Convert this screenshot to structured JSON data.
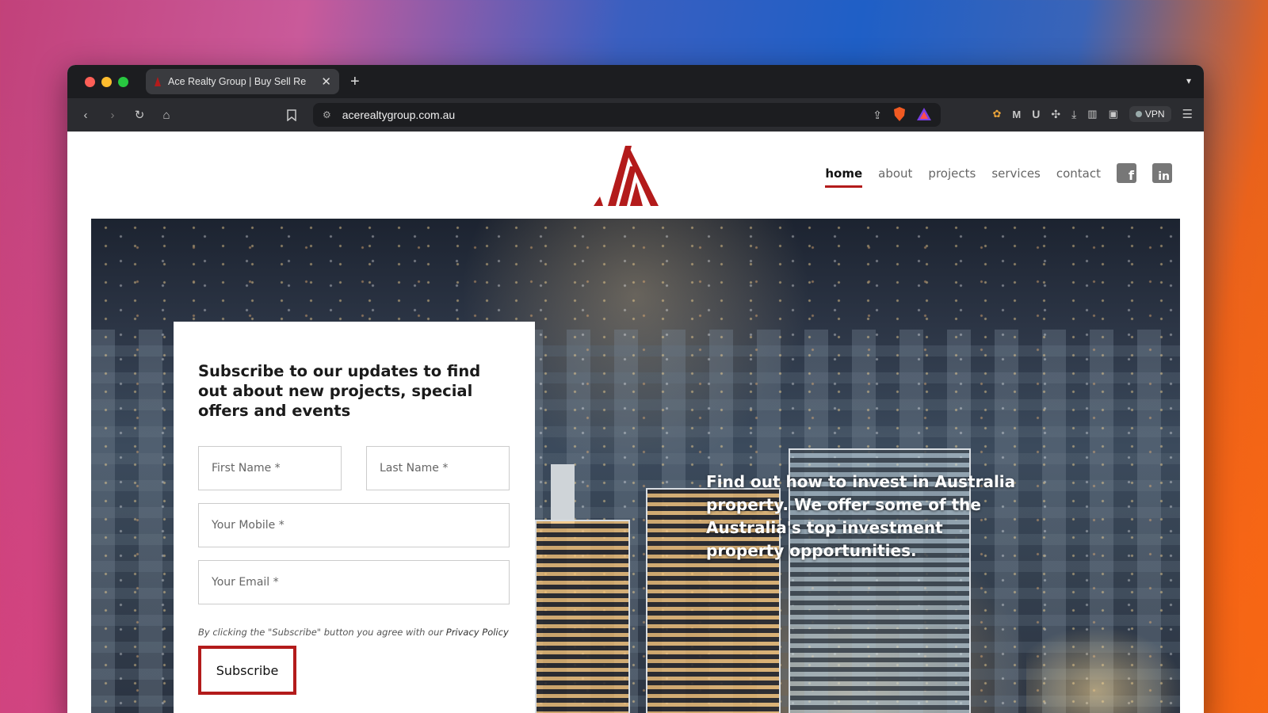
{
  "browser": {
    "tab_title": "Ace Realty Group | Buy Sell Re",
    "url": "acerealtygroup.com.au",
    "vpn_label": "VPN",
    "new_tab_symbol": "+",
    "close_symbol": "✕"
  },
  "site": {
    "nav": [
      {
        "label": "home",
        "active": true
      },
      {
        "label": "about",
        "active": false
      },
      {
        "label": "projects",
        "active": false
      },
      {
        "label": "services",
        "active": false
      },
      {
        "label": "contact",
        "active": false
      }
    ],
    "brand_color": "#b31b1b"
  },
  "form": {
    "title": "Subscribe to our updates to find out about new projects, special offers and events",
    "first_name_placeholder": "First Name *",
    "last_name_placeholder": "Last Name *",
    "mobile_placeholder": "Your Mobile *",
    "email_placeholder": "Your Email *",
    "disclaimer": "By clicking the \"Subscribe\" button you agree with our ",
    "privacy_link": "Privacy Policy",
    "subscribe_label": "Subscribe"
  },
  "hero": {
    "tagline": "Find out how to invest in Australia property. We offer some of the Australia's top investment property opportunities."
  },
  "icons": {
    "facebook": "f",
    "linkedin": "in"
  }
}
